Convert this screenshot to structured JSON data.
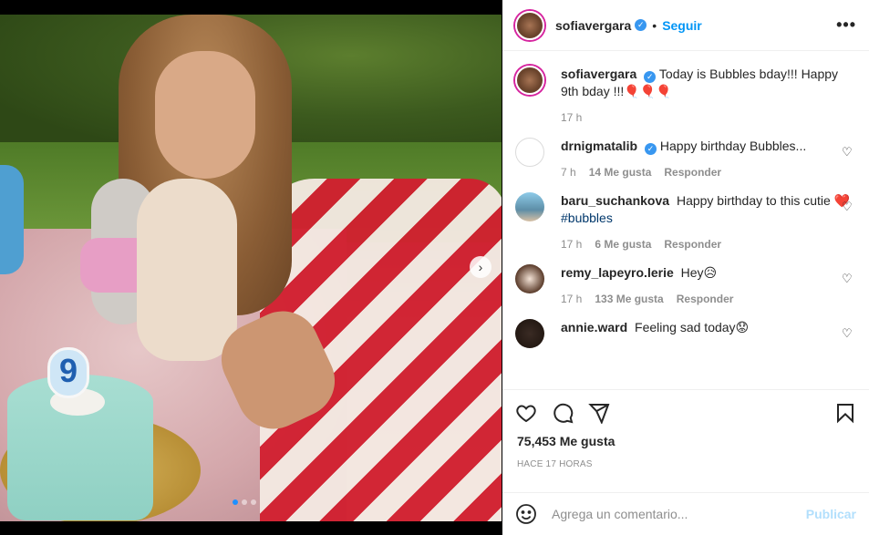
{
  "photo": {
    "candle_digit": "9",
    "next_icon": "chevron-right-icon",
    "carousel_dots": 3,
    "active_dot_index": 0
  },
  "header": {
    "username": "sofiavergara",
    "separator": "•",
    "follow_label": "Seguir",
    "more_label": "•••"
  },
  "caption": {
    "username": "sofiavergara",
    "text": "Today is Bubbles bday!!! Happy 9th bday !!!🎈🎈🎈",
    "time": "17 h"
  },
  "comments": [
    {
      "username": "drnigmatalib",
      "verified": true,
      "text": "Happy birthday Bubbles...",
      "hashtag": "",
      "time": "7 h",
      "likes": "14 Me gusta",
      "reply": "Responder"
    },
    {
      "username": "baru_suchankova",
      "verified": false,
      "text": "Happy birthday to this cutie ❤️",
      "hashtag": "#bubbles",
      "time": "17 h",
      "likes": "6 Me gusta",
      "reply": "Responder"
    },
    {
      "username": "remy_lapeyro.lerie",
      "verified": false,
      "text": "Hey😥",
      "hashtag": "",
      "time": "17 h",
      "likes": "133 Me gusta",
      "reply": "Responder"
    },
    {
      "username": "annie.ward",
      "verified": false,
      "text": "Feeling sad today😟",
      "hashtag": "",
      "time": "",
      "likes": "",
      "reply": ""
    }
  ],
  "actions": {
    "like_icon": "heart-icon",
    "comment_icon": "comment-icon",
    "share_icon": "send-icon",
    "save_icon": "bookmark-icon"
  },
  "likes": "75,453 Me gusta",
  "posted": "HACE 17 HORAS",
  "composer": {
    "placeholder": "Agrega un comentario...",
    "post_label": "Publicar",
    "emoji_icon": "smiley-icon"
  },
  "colors": {
    "link": "#0095f6",
    "verified": "#3897f0",
    "muted": "#8e8e8e",
    "post_disabled": "#b2dffc",
    "hashtag": "#00376b"
  }
}
